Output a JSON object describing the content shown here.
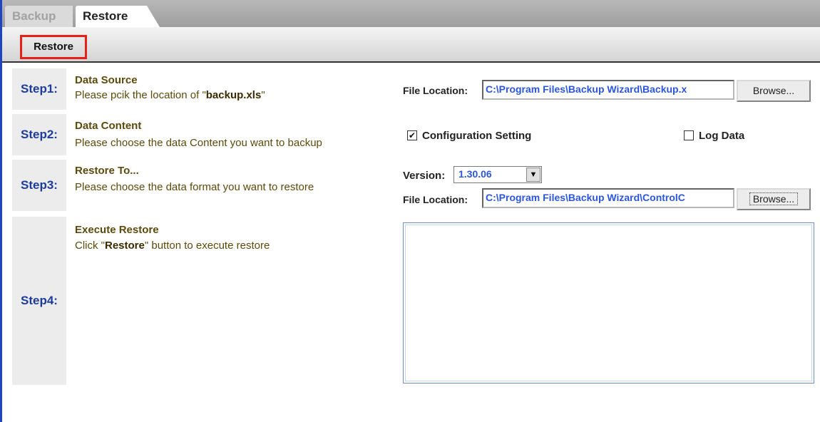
{
  "tabs": [
    {
      "label": "Backup",
      "active": false
    },
    {
      "label": "Restore",
      "active": true
    }
  ],
  "toolbar": {
    "restore_label": "Restore"
  },
  "steps": [
    {
      "label": "Step1:",
      "title": "Data Source",
      "desc_prefix": "Please pcik the location of \"",
      "desc_bold": "backup.xls",
      "desc_suffix": "\""
    },
    {
      "label": "Step2:",
      "title": "Data Content",
      "desc": "Please choose the data Content you want to backup"
    },
    {
      "label": "Step3:",
      "title": "Restore To...",
      "desc": "Please choose the data format you want to restore"
    },
    {
      "label": "Step4:",
      "title": "Execute Restore",
      "desc_prefix": "Click \"",
      "desc_bold": "Restore",
      "desc_suffix": "\" button to execute restore"
    }
  ],
  "step1": {
    "file_location_label": "File Location:",
    "file_path": "C:\\Program Files\\Backup Wizard\\Backup.x",
    "browse_label": "Browse..."
  },
  "step2": {
    "config_label": "Configuration Setting",
    "config_checked": true,
    "log_label": "Log Data",
    "log_checked": false
  },
  "step3": {
    "version_label": "Version:",
    "version_value": "1.30.06",
    "file_location_label": "File Location:",
    "file_path": "C:\\Program Files\\Backup Wizard\\ControlC",
    "browse_label": "Browse..."
  },
  "icons": {
    "checkmark": "check-icon",
    "dropdown": "chevron-down-icon"
  },
  "colors": {
    "accent_blue": "#1c44c4",
    "highlight_red": "#e8201c",
    "path_blue": "#2b56dc"
  }
}
